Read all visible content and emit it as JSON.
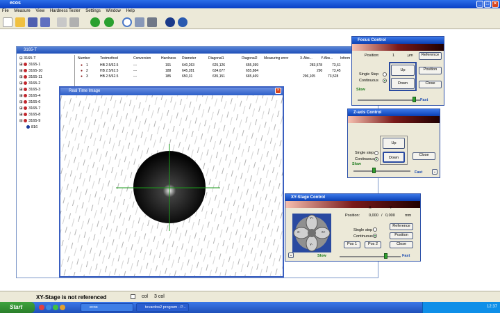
{
  "app": {
    "title": "ecos"
  },
  "menu": [
    "File",
    "Measure",
    "View",
    "Hardness Tester",
    "Settings",
    "Window",
    "Help"
  ],
  "toolbar": {
    "icons": [
      "new-icon",
      "open-icon",
      "save-icon",
      "save-all-icon",
      "print-icon",
      "print-preview-icon",
      "download-icon",
      "upload-icon",
      "lens-icon",
      "settings-icon",
      "stage-icon",
      "camera-icon",
      "focus-icon"
    ]
  },
  "child_window": {
    "title": "3165-T"
  },
  "tree": {
    "root": "3165-T",
    "items": [
      "3165-1",
      "3165-10",
      "3165-11",
      "3165-2",
      "3165-3",
      "3165-4",
      "3165-6",
      "3165-7",
      "3165-8",
      "3165-9"
    ],
    "leaf": "816"
  },
  "table": {
    "headers": [
      "Number",
      "Testmethod",
      "Conversion",
      "Hardness",
      "Diameter",
      "Diagonal1",
      "Diagonal2",
      "Measuring error",
      "X-Abs...",
      "Y-Abs...",
      "Inform"
    ],
    "rows": [
      [
        "1",
        "HB 2.5/62.5",
        "---",
        "191",
        "640,263",
        "625,126",
        "655,399",
        "",
        "283,578",
        "73,61",
        ""
      ],
      [
        "2",
        "HB 2.5/62.5",
        "---",
        "188",
        "645,281",
        "634,677",
        "655,884",
        "",
        "290",
        "73,45",
        ""
      ],
      [
        "3",
        "HB 2.5/62.5",
        "---",
        "185",
        "650,31",
        "635,151",
        "665,469",
        "",
        "296,105",
        "73,528",
        ""
      ]
    ]
  },
  "rti": {
    "title": "Real Time Image"
  },
  "focus": {
    "title": "Focus Control",
    "position_label": "Position:",
    "position_value": "1",
    "unit": "µm",
    "single_step": "Single Step",
    "continuous": "Continuous",
    "up": "Up",
    "down": "Down",
    "reference": "Reference",
    "position_btn": "Position",
    "close": "Close",
    "slow": "Slow",
    "fast": "Fast",
    "speed": 0.9
  },
  "zaxis": {
    "title": "Z-axis Control",
    "single_step": "Single step",
    "continuous": "Continuous",
    "up": "Up",
    "down": "Down",
    "close": "Close",
    "slow": "Slow",
    "fast": "Fast",
    "speed": 0.35
  },
  "xy": {
    "title": "XY-Stage Control",
    "x_label": "X",
    "y_label": "Y",
    "position_label": "Position:",
    "x_value": "0,000",
    "sep": "/",
    "y_value": "0,000",
    "unit": "mm",
    "single_step": "Single step",
    "continuous": "Continuous",
    "reference": "Reference",
    "position_btn": "Position",
    "pos1": "Pos 1",
    "pos2": "Pos 2",
    "close": "Close",
    "slow": "Slow",
    "fast": "Fast",
    "speed": 0.75,
    "joy": {
      "up": "Y+",
      "down": "Y-",
      "left": "X-",
      "right": "X+"
    }
  },
  "status": {
    "text": "XY-Stage is not referenced",
    "col": "col",
    "col_value": "3 col"
  },
  "taskbar": {
    "start": "Start",
    "tasks": [
      "ecos",
      "tevardos2 program - P..."
    ],
    "clock": "12:37"
  }
}
